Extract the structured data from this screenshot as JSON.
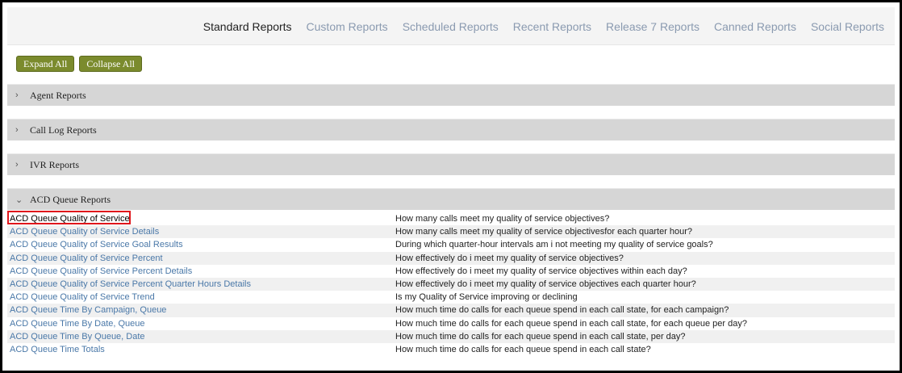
{
  "tabs": [
    {
      "label": "Standard Reports",
      "active": true
    },
    {
      "label": "Custom Reports",
      "active": false
    },
    {
      "label": "Scheduled Reports",
      "active": false
    },
    {
      "label": "Recent Reports",
      "active": false
    },
    {
      "label": "Release 7 Reports",
      "active": false
    },
    {
      "label": "Canned Reports",
      "active": false
    },
    {
      "label": "Social Reports",
      "active": false
    }
  ],
  "buttons": {
    "expand_all": "Expand All",
    "collapse_all": "Collapse All"
  },
  "sections": [
    {
      "title": "Agent Reports",
      "expanded": false
    },
    {
      "title": "Call Log Reports",
      "expanded": false
    },
    {
      "title": "IVR Reports",
      "expanded": false
    },
    {
      "title": "ACD Queue Reports",
      "expanded": true
    }
  ],
  "reports": [
    {
      "name": "ACD Queue Quality of Service",
      "desc": "How many calls meet my quality of service objectives?"
    },
    {
      "name": "ACD Queue Quality of Service Details",
      "desc": "How many calls meet my quality of service objectivesfor each quarter hour?"
    },
    {
      "name": "ACD Queue Quality of Service Goal Results",
      "desc": "During which quarter-hour intervals am i not meeting my quality of service goals?"
    },
    {
      "name": "ACD Queue Quality of Service Percent",
      "desc": "How effectively do i meet my quality of service objectives?"
    },
    {
      "name": "ACD Queue Quality of Service Percent Details",
      "desc": "How effectively do i meet my quality of service objectives within each day?"
    },
    {
      "name": "ACD Queue Quality of Service Percent Quarter Hours Details",
      "desc": "How effectively do i meet my quality of service objectives each quarter hour?"
    },
    {
      "name": "ACD Queue Quality of Service Trend",
      "desc": "Is my Quality of Service improving or declining"
    },
    {
      "name": "ACD Queue Time By Campaign, Queue",
      "desc": "How much time do calls for each queue spend in each call state, for each campaign?"
    },
    {
      "name": "ACD Queue Time By Date, Queue",
      "desc": "How much time do calls for each queue spend in each call state, for each queue per day?"
    },
    {
      "name": "ACD Queue Time By Queue, Date",
      "desc": "How much time do calls for each queue spend in each call state, per day?"
    },
    {
      "name": "ACD Queue Time Totals",
      "desc": "How much time do calls for each queue spend in each call state?"
    }
  ],
  "colors": {
    "button_green": "#7b8b2d",
    "link_blue": "#4a78a8",
    "highlight_red": "#e0161b"
  }
}
